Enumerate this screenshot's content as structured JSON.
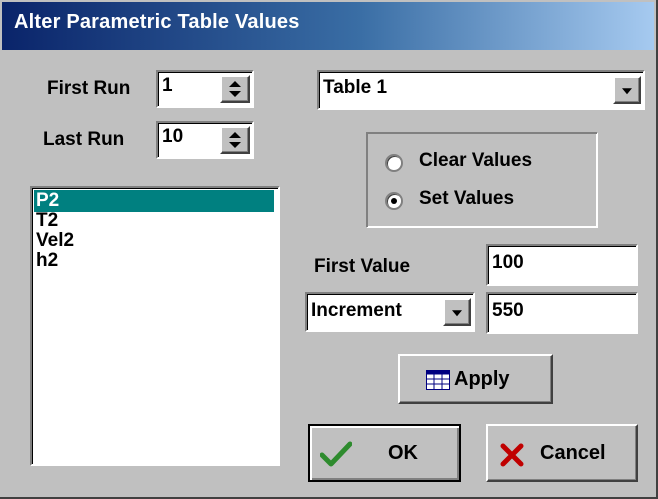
{
  "window": {
    "title": "Alter Parametric Table Values"
  },
  "runs": {
    "first_label": "First Run",
    "first_value": "1",
    "last_label": "Last Run",
    "last_value": "10"
  },
  "table_select": {
    "value": "Table 1"
  },
  "variables": [
    "P2",
    "T2",
    "Vel2",
    "h2"
  ],
  "selected_variable": "P2",
  "mode": {
    "clear_label": "Clear Values",
    "set_label": "Set Values",
    "selected": "Set Values"
  },
  "values": {
    "first_label": "First Value",
    "first_value": "100",
    "step_type": "Increment",
    "step_value": "550"
  },
  "buttons": {
    "apply": "Apply",
    "ok": "OK",
    "cancel": "Cancel"
  },
  "colors": {
    "selection": "#008080",
    "ok_check": "#2e8b2e",
    "cancel_x": "#c00000"
  }
}
